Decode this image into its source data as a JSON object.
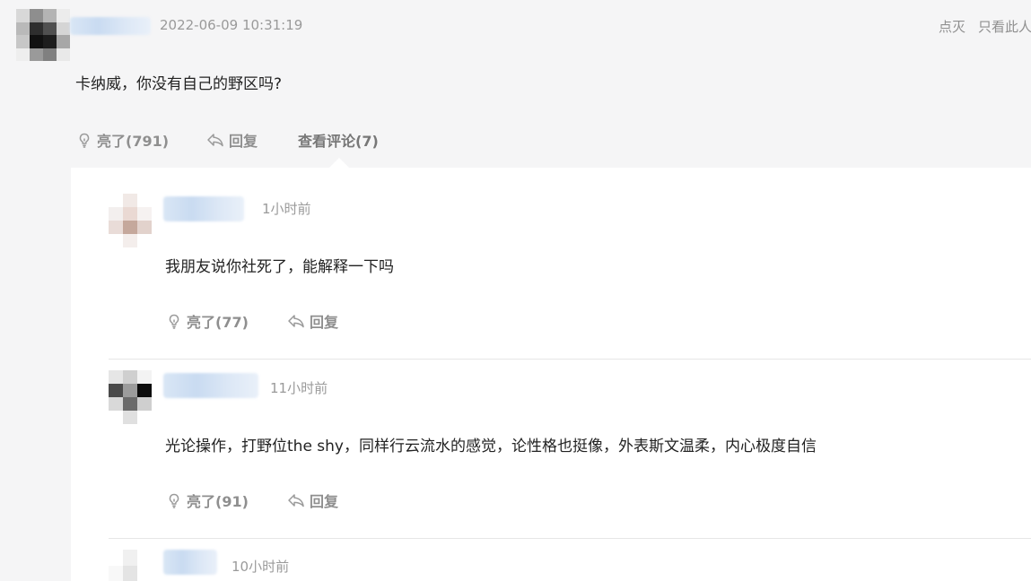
{
  "post": {
    "timestamp": "2022-06-09 10:31:19",
    "text": "卡纳威，你没有自己的野区吗?",
    "header_actions": {
      "dislike_label": "点灭",
      "only_author_label": "只看此人"
    },
    "actions": {
      "like_label": "亮了(791)",
      "reply_label": "回复",
      "view_comments_label": "查看评论(7)"
    }
  },
  "comments": [
    {
      "time": "1小时前",
      "text": "我朋友说你社死了，能解释一下吗",
      "like_label": "亮了(77)",
      "reply_label": "回复"
    },
    {
      "time": "11小时前",
      "text": "光论操作，打野位the shy，同样行云流水的感觉，论性格也挺像，外表斯文温柔，内心极度自信",
      "like_label": "亮了(91)",
      "reply_label": "回复"
    },
    {
      "time": "10小时前"
    }
  ],
  "icons": {
    "like": "lightbulb-icon",
    "reply": "reply-arrow-icon"
  },
  "colors": {
    "background": "#f5f5f6",
    "panel": "#ffffff",
    "muted_text": "#9a9a9a",
    "action_text": "#8f8f8f"
  }
}
